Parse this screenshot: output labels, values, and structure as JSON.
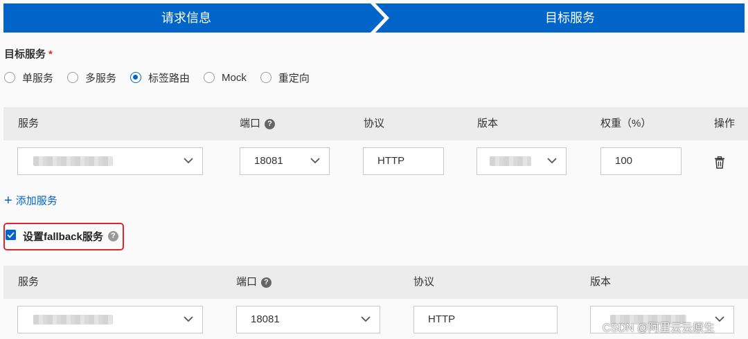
{
  "steps": {
    "step1_label": "请求信息",
    "step2_label": "目标服务",
    "color": "#0064c8"
  },
  "target_service": {
    "label": "目标服务",
    "required_mark": "*",
    "options": [
      "单服务",
      "多服务",
      "标签路由",
      "Mock",
      "重定向"
    ],
    "selected": "标签路由"
  },
  "service_table": {
    "headers": {
      "service": "服务",
      "port": "端口",
      "protocol": "协议",
      "version": "版本",
      "weight": "权重（%）",
      "action": "操作"
    },
    "row": {
      "port": "18081",
      "protocol": "HTTP",
      "weight": "100"
    },
    "delete_icon": "trash-icon"
  },
  "add_service_label": "添加服务",
  "fallback": {
    "label": "设置fallback服务",
    "checked": true,
    "highlight_color": "#e0252b"
  },
  "fallback_table": {
    "headers": {
      "service": "服务",
      "port": "端口",
      "protocol": "协议",
      "version": "版本"
    },
    "row": {
      "port": "18081",
      "protocol": "HTTP"
    }
  },
  "help_icon_glyph": "?",
  "watermark": "CSDN @阿里云云原生"
}
